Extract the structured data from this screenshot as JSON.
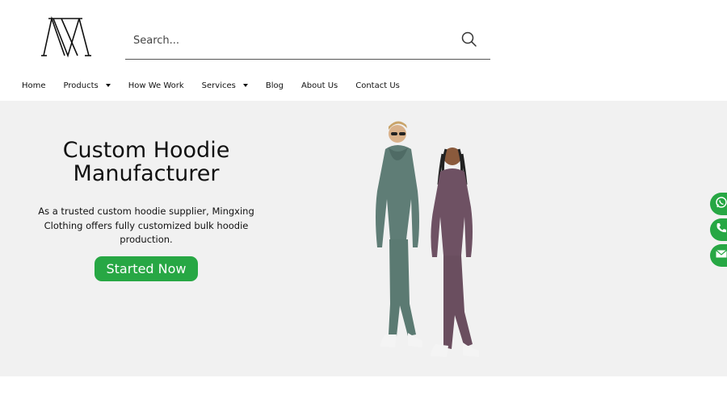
{
  "header": {
    "logo_icon": "mx-monogram-logo-icon",
    "search": {
      "placeholder": "Search...",
      "icon": "search-icon"
    }
  },
  "nav": {
    "items": [
      {
        "label": "Home",
        "dropdown": false
      },
      {
        "label": "Products",
        "dropdown": true
      },
      {
        "label": "How We Work",
        "dropdown": false
      },
      {
        "label": "Services",
        "dropdown": true
      },
      {
        "label": "Blog",
        "dropdown": false
      },
      {
        "label": "About Us",
        "dropdown": false
      },
      {
        "label": "Contact Us",
        "dropdown": false
      }
    ]
  },
  "hero": {
    "title": "Custom  Hoodie\nManufacturer",
    "description": "As a trusted custom hoodie supplier, Mingxing Clothing offers fully customized bulk hoodie production.",
    "cta_label": "Started Now"
  },
  "floating_contacts": [
    {
      "icon": "whatsapp-icon"
    },
    {
      "icon": "phone-icon"
    },
    {
      "icon": "email-icon"
    }
  ],
  "colors": {
    "accent_green": "#27a744",
    "hero_background": "#f1f1f1",
    "hoodie_green": "#5f7d76",
    "hoodie_plum": "#6e5163"
  }
}
